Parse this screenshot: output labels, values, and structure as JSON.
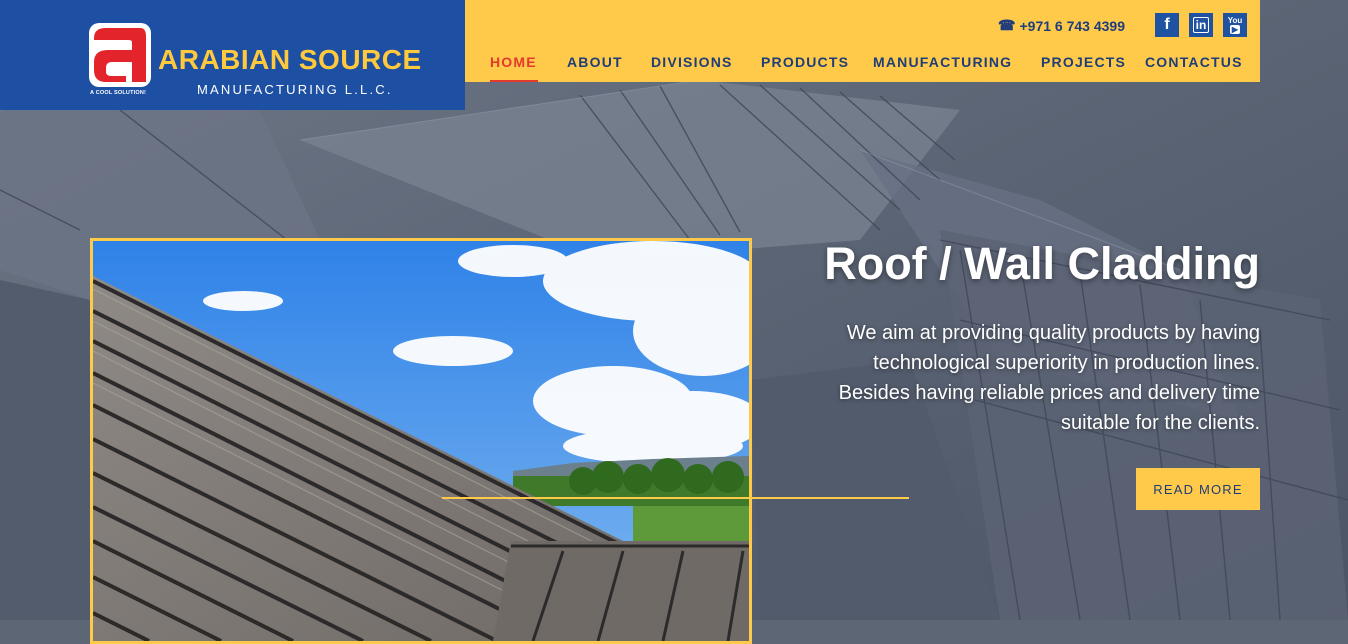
{
  "brand": {
    "name": "ARABIAN SOURCE",
    "subtitle": "MANUFACTURING L.L.C.",
    "tagline": "A COOL SOLUTION!"
  },
  "contact": {
    "phone": "+971 6 743 4399",
    "phone_icon": "phone-icon"
  },
  "social": [
    {
      "icon": "facebook-icon",
      "glyph": "f"
    },
    {
      "icon": "linkedin-icon",
      "glyph": "in"
    },
    {
      "icon": "youtube-icon",
      "glyph": "You"
    }
  ],
  "nav": {
    "items": [
      {
        "label": "HOME",
        "active": true
      },
      {
        "label": "ABOUT"
      },
      {
        "label": "DIVISIONS"
      },
      {
        "label": "PRODUCTS"
      },
      {
        "label": "MANUFACTURING"
      },
      {
        "label": "PROJECTS"
      },
      {
        "label": "CONTACTUS"
      }
    ]
  },
  "hero": {
    "title": "Roof / Wall Cladding",
    "text": "We aim at providing quality products by having technological superiority in production lines. Besides having reliable prices and delivery time suitable for the clients.",
    "button": "READ MORE"
  },
  "colors": {
    "brand_blue": "#1d4fa3",
    "accent_yellow": "#ffc94a",
    "active_red": "#e33a2f",
    "nav_text": "#1f3e78"
  }
}
